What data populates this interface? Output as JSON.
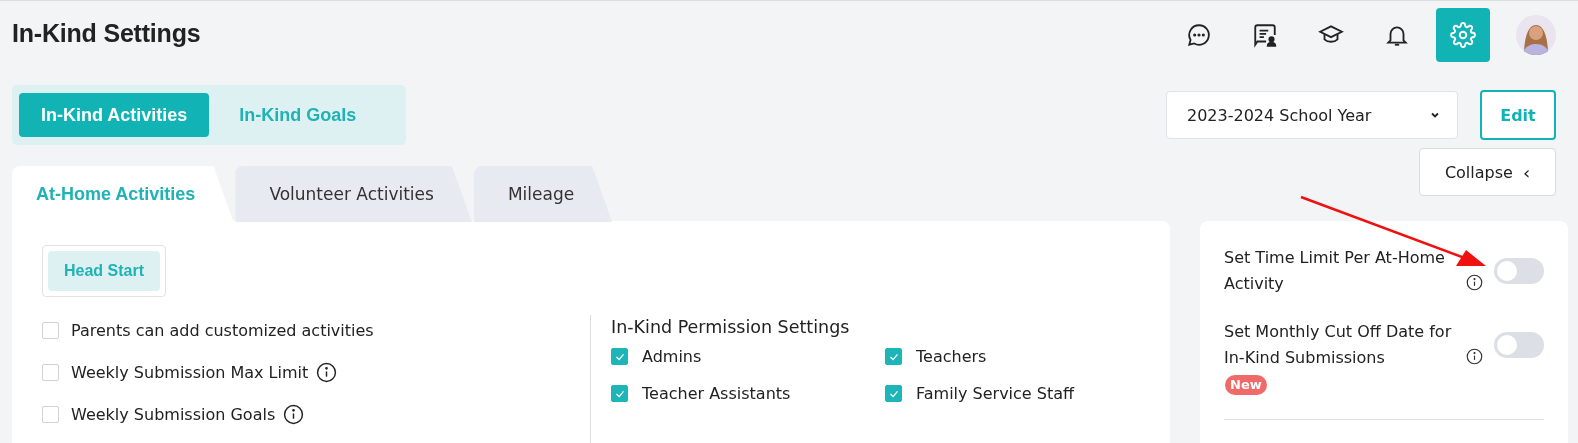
{
  "page_title": "In-Kind Settings",
  "header_icons": [
    {
      "kind": "chat",
      "selected": false
    },
    {
      "kind": "presentation",
      "selected": false
    },
    {
      "kind": "graduation",
      "selected": false
    },
    {
      "kind": "bell",
      "selected": false
    },
    {
      "kind": "settings",
      "selected": true
    }
  ],
  "section_tabs": [
    {
      "label": "In-Kind Activities",
      "selected": true
    },
    {
      "label": "In-Kind Goals",
      "selected": false
    }
  ],
  "school_year": {
    "value": "2023-2024 School Year"
  },
  "edit_button": "Edit",
  "collapse_button": "Collapse",
  "collapse_glyph": "‹",
  "activity_tabs": [
    {
      "label": "At-Home Activities",
      "selected": true
    },
    {
      "label": "Volunteer Activities",
      "selected": false
    },
    {
      "label": "Mileage",
      "selected": false
    }
  ],
  "program_chips": [
    {
      "label": "Head Start",
      "selected": true
    }
  ],
  "options": [
    {
      "label": "Parents can add customized activities",
      "checked": false,
      "info": false
    },
    {
      "label": "Weekly Submission Max Limit",
      "checked": false,
      "info": true
    },
    {
      "label": "Weekly Submission Goals",
      "checked": false,
      "info": true
    }
  ],
  "permissions": {
    "title": "In-Kind Permission Settings",
    "items": [
      {
        "label": "Admins",
        "checked": true
      },
      {
        "label": "Teachers",
        "checked": true
      },
      {
        "label": "Teacher Assistants",
        "checked": true
      },
      {
        "label": "Family Service Staff",
        "checked": true
      }
    ]
  },
  "side_settings": [
    {
      "label": "Set Time Limit Per At-Home Activity",
      "on": false
    },
    {
      "label": "Set Monthly Cut Off Date for In-Kind Submissions",
      "on": false,
      "badge": "New"
    }
  ]
}
